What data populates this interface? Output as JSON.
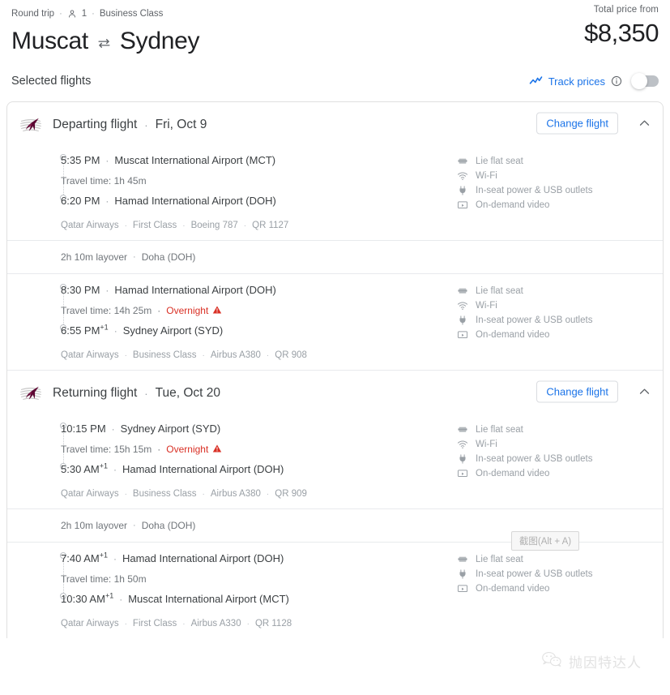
{
  "header": {
    "trip_type": "Round trip",
    "passenger_icon": "person-icon",
    "passenger_count": "1",
    "cabin_class": "Business Class",
    "origin": "Muscat",
    "swap_icon": "swap-arrows-icon",
    "destination": "Sydney",
    "price_label": "Total price from",
    "price_value": "$8,350",
    "separator": "·"
  },
  "toolbar": {
    "selected_flights_label": "Selected flights",
    "track_prices_label": "Track prices",
    "track_chart_icon": "trending-chart-icon",
    "info_icon": "info-circle-icon",
    "toggle_state": "off"
  },
  "colors": {
    "accent_blue": "#1a73e8",
    "warning_red": "#d93025",
    "qatar_maroon": "#5c0632",
    "text_primary": "#3c4043",
    "text_muted": "#9aa0a6"
  },
  "sections": [
    {
      "title": "Departing flight",
      "separator": "·",
      "date": "Fri, Oct 9",
      "airline_logo": "qatar-airways-logo",
      "change_flight_label": "Change flight",
      "collapse_icon": "chevron-up-icon",
      "legs": [
        {
          "depart_time": "5:35 PM",
          "depart_plus": "",
          "depart_airport": "Muscat International Airport (MCT)",
          "travel_time": "Travel time: 1h 45m",
          "overnight": "",
          "arrive_time": "6:20 PM",
          "arrive_plus": "",
          "arrive_airport": "Hamad International Airport (DOH)",
          "airline": "Qatar Airways",
          "cabin": "First Class",
          "aircraft": "Boeing 787",
          "flight_number": "QR 1127",
          "amenities": [
            {
              "icon": "lie-flat-seat-icon",
              "label": "Lie flat seat"
            },
            {
              "icon": "wifi-icon",
              "label": "Wi-Fi"
            },
            {
              "icon": "power-plug-icon",
              "label": "In-seat power & USB outlets"
            },
            {
              "icon": "video-screen-icon",
              "label": "On-demand video"
            }
          ]
        },
        {
          "depart_time": "8:30 PM",
          "depart_plus": "",
          "depart_airport": "Hamad International Airport (DOH)",
          "travel_time": "Travel time: 14h 25m",
          "overnight": "Overnight",
          "arrive_time": "6:55 PM",
          "arrive_plus": "+1",
          "arrive_airport": "Sydney Airport (SYD)",
          "airline": "Qatar Airways",
          "cabin": "Business Class",
          "aircraft": "Airbus A380",
          "flight_number": "QR 908",
          "amenities": [
            {
              "icon": "lie-flat-seat-icon",
              "label": "Lie flat seat"
            },
            {
              "icon": "wifi-icon",
              "label": "Wi-Fi"
            },
            {
              "icon": "power-plug-icon",
              "label": "In-seat power & USB outlets"
            },
            {
              "icon": "video-screen-icon",
              "label": "On-demand video"
            }
          ]
        }
      ],
      "layover": {
        "duration": "2h 10m layover",
        "separator": "·",
        "airport": "Doha (DOH)"
      }
    },
    {
      "title": "Returning flight",
      "separator": "·",
      "date": "Tue, Oct 20",
      "airline_logo": "qatar-airways-logo",
      "change_flight_label": "Change flight",
      "collapse_icon": "chevron-up-icon",
      "legs": [
        {
          "depart_time": "10:15 PM",
          "depart_plus": "",
          "depart_airport": "Sydney Airport (SYD)",
          "travel_time": "Travel time: 15h 15m",
          "overnight": "Overnight",
          "arrive_time": "5:30 AM",
          "arrive_plus": "+1",
          "arrive_airport": "Hamad International Airport (DOH)",
          "airline": "Qatar Airways",
          "cabin": "Business Class",
          "aircraft": "Airbus A380",
          "flight_number": "QR 909",
          "amenities": [
            {
              "icon": "lie-flat-seat-icon",
              "label": "Lie flat seat"
            },
            {
              "icon": "wifi-icon",
              "label": "Wi-Fi"
            },
            {
              "icon": "power-plug-icon",
              "label": "In-seat power & USB outlets"
            },
            {
              "icon": "video-screen-icon",
              "label": "On-demand video"
            }
          ]
        },
        {
          "depart_time": "7:40 AM",
          "depart_plus": "+1",
          "depart_airport": "Hamad International Airport (DOH)",
          "travel_time": "Travel time: 1h 50m",
          "overnight": "",
          "arrive_time": "10:30 AM",
          "arrive_plus": "+1",
          "arrive_airport": "Muscat International Airport (MCT)",
          "airline": "Qatar Airways",
          "cabin": "First Class",
          "aircraft": "Airbus A330",
          "flight_number": "QR 1128",
          "amenities": [
            {
              "icon": "lie-flat-seat-icon",
              "label": "Lie flat seat"
            },
            {
              "icon": "power-plug-icon",
              "label": "In-seat power & USB outlets"
            },
            {
              "icon": "video-screen-icon",
              "label": "On-demand video"
            }
          ]
        }
      ],
      "layover": {
        "duration": "2h 10m layover",
        "separator": "·",
        "airport": "Doha (DOH)"
      }
    }
  ],
  "overlays": {
    "snip_tooltip": "截图(Alt + A)",
    "watermark_text": "抛因特达人",
    "watermark_icon": "wechat-logo-icon"
  }
}
